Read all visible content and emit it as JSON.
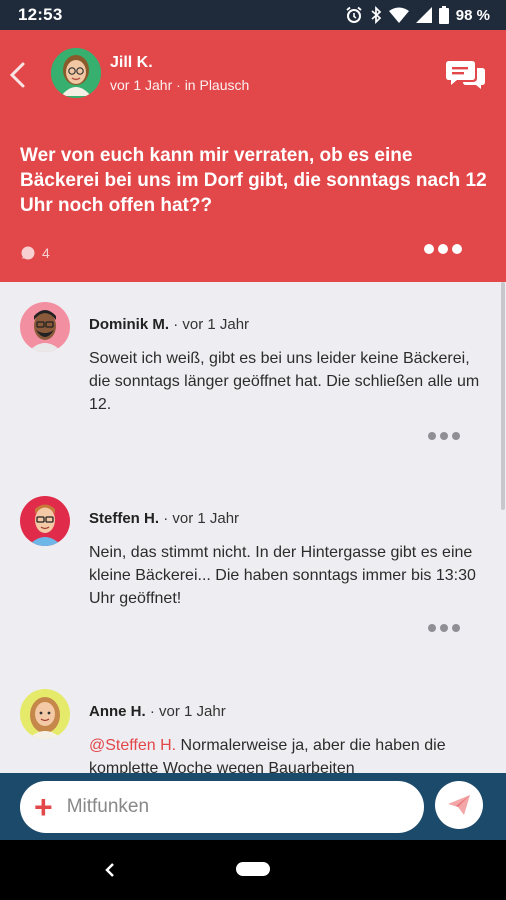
{
  "status": {
    "time": "12:53",
    "battery": "98 %"
  },
  "header": {
    "author": "Jill K.",
    "meta": "vor 1 Jahr · in Plausch",
    "question": "Wer von euch kann mir verraten, ob es eine Bäckerei bei uns im Dorf gibt, die sonntags nach 12 Uhr noch offen hat??",
    "comment_count": "4"
  },
  "comments": [
    {
      "name": "Dominik M.",
      "time": "· vor 1 Jahr",
      "mention": "",
      "text": "Soweit ich weiß, gibt es bei uns leider keine Bäckerei, die sonntags länger geöffnet hat. Die schließen alle um 12."
    },
    {
      "name": "Steffen H.",
      "time": "· vor 1 Jahr",
      "mention": "",
      "text": "Nein, das stimmt nicht. In der Hintergasse gibt es eine kleine Bäckerei... Die haben sonntags immer bis 13:30 Uhr geöffnet!"
    },
    {
      "name": "Anne H.",
      "time": "· vor 1 Jahr",
      "mention": "@Steffen H.",
      "text": " Normalerweise ja, aber die haben die komplette Woche wegen Bauarbeiten"
    }
  ],
  "compose": {
    "placeholder": "Mitfunken"
  },
  "colors": {
    "accent": "#e2474a",
    "compose_bar": "#1b4a6b",
    "status_bar": "#1f2b3b"
  }
}
